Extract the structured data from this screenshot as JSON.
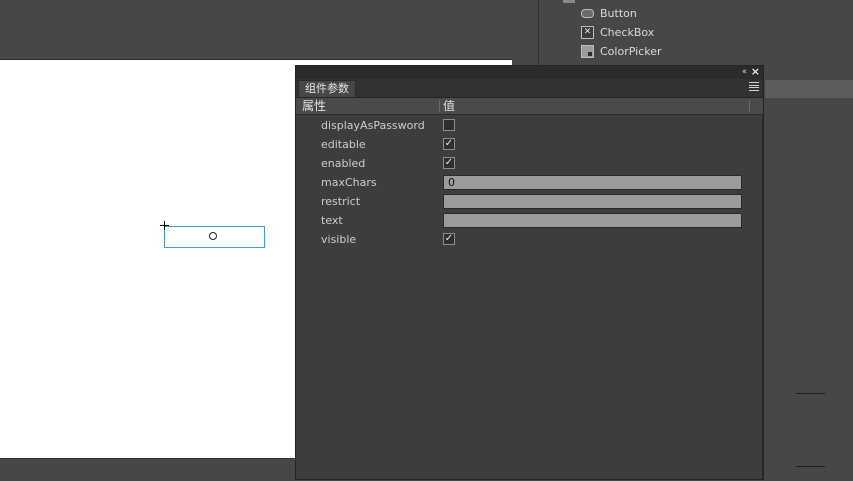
{
  "library": {
    "items": [
      {
        "label": "Button",
        "icon": "button-icon"
      },
      {
        "label": "CheckBox",
        "icon": "checkbox-icon"
      },
      {
        "label": "ColorPicker",
        "icon": "colorpicker-icon"
      }
    ]
  },
  "stage": {
    "component_text": "O"
  },
  "panel": {
    "tab_label": "组件参数",
    "collapse_glyph": "‹‹",
    "close_glyph": "×",
    "columns": {
      "property": "属性",
      "value": "值"
    },
    "params": [
      {
        "name": "displayAsPassword",
        "type": "checkbox",
        "checked": false
      },
      {
        "name": "editable",
        "type": "checkbox",
        "checked": true
      },
      {
        "name": "enabled",
        "type": "checkbox",
        "checked": true
      },
      {
        "name": "maxChars",
        "type": "text",
        "value": "0"
      },
      {
        "name": "restrict",
        "type": "text",
        "value": ""
      },
      {
        "name": "text",
        "type": "text",
        "value": ""
      },
      {
        "name": "visible",
        "type": "checkbox",
        "checked": true
      }
    ]
  },
  "colors": {
    "workspace": "#474747",
    "panel_bg": "#3d3d3d",
    "field_bg": "#9b9b9b",
    "component_border": "#3d9dc4"
  }
}
